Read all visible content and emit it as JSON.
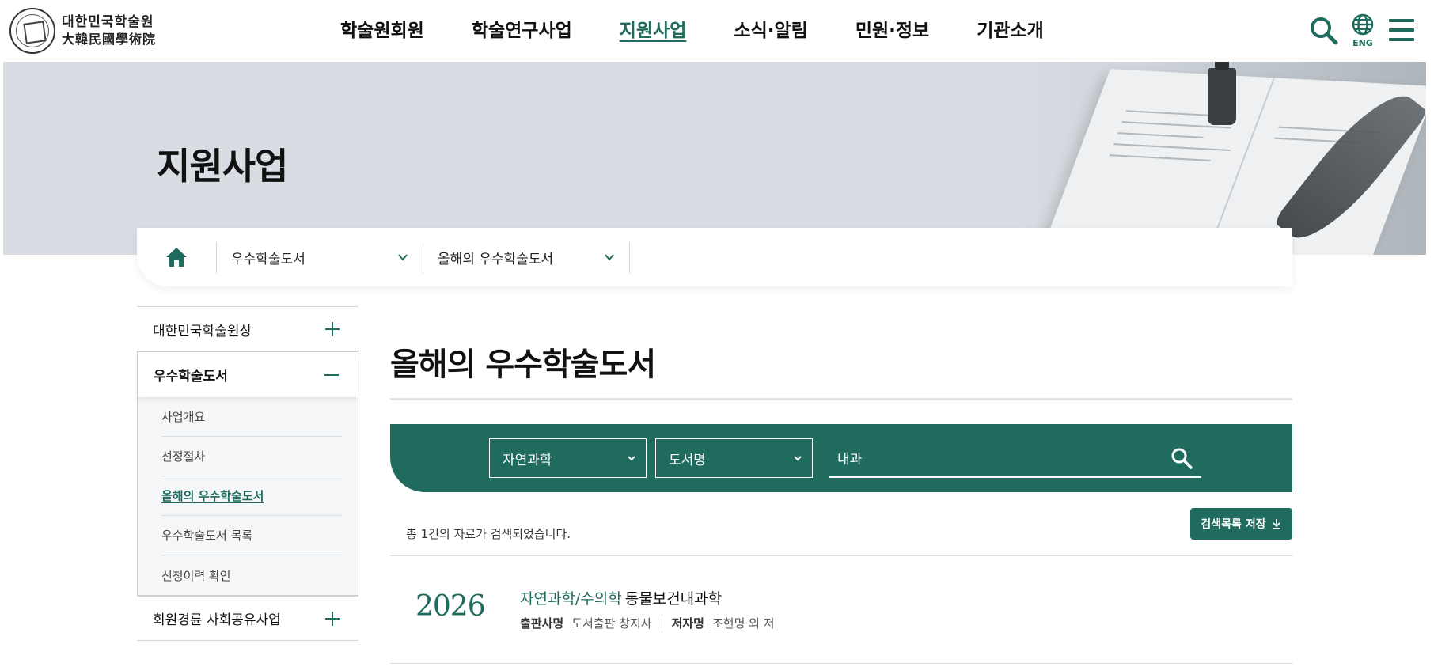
{
  "header": {
    "logo_line1": "대한민국학술원",
    "logo_line2": "大韓民國學術院",
    "nav": [
      "학술원회원",
      "학술연구사업",
      "지원사업",
      "소식·알림",
      "민원·정보",
      "기관소개"
    ],
    "active_nav": "지원사업",
    "lang_label": "ENG"
  },
  "visual": {
    "title": "지원사업"
  },
  "location": {
    "depth1": "우수학술도서",
    "depth2": "올해의 우수학술도서"
  },
  "lnb": {
    "item1": "대한민국학술원상",
    "item2": "우수학술도서",
    "sub": [
      "사업개요",
      "선정절차",
      "올해의 우수학술도서",
      "우수학술도서 목록",
      "신청이력 확인"
    ],
    "item3": "회원경륜 사회공유사업"
  },
  "content": {
    "title": "올해의 우수학술도서",
    "search": {
      "field": "자연과학",
      "type": "도서명",
      "keyword": "내과"
    },
    "result_count": "총 1건의 자료가 검색되었습니다.",
    "save_label": "검색목록 저장",
    "items": [
      {
        "year": "2026",
        "category": "자연과학/수의학",
        "title": "동물보건내과학",
        "publisher_label": "출판사명",
        "publisher": "도서출판 창지사",
        "author_label": "저자명",
        "author": "조현명 외 저"
      }
    ]
  },
  "colors": {
    "accent": "#1f6b5e",
    "banner": "#d7dde2"
  }
}
